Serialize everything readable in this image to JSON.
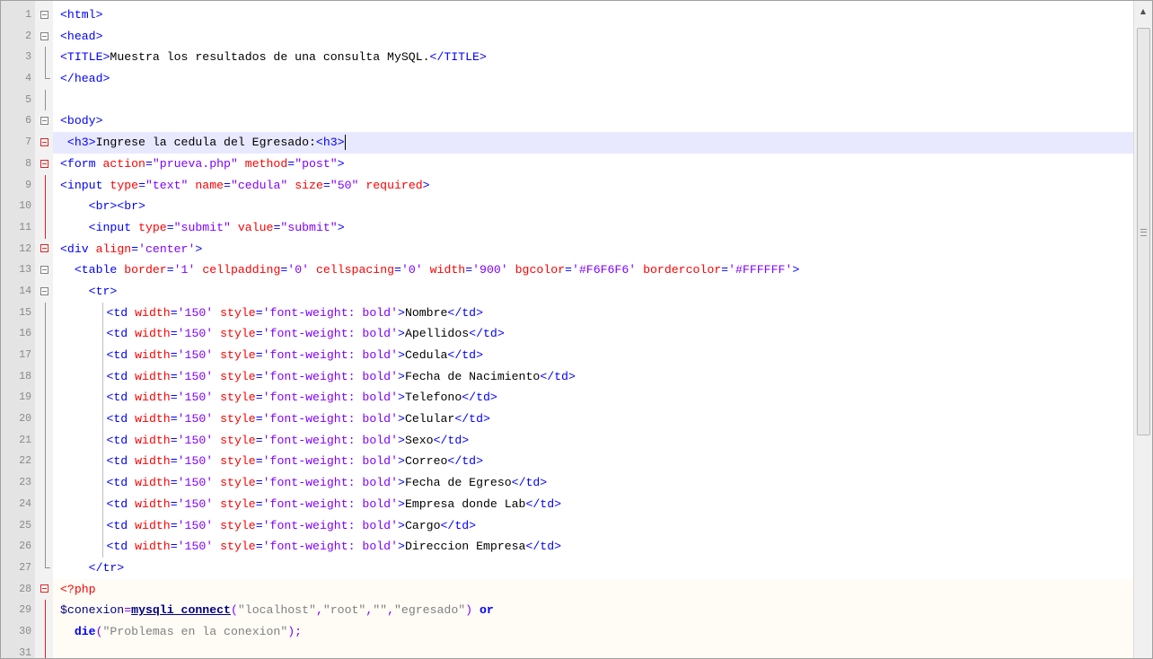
{
  "editor": {
    "scroll_up_glyph": "▲",
    "lines": [
      {
        "n": "1",
        "fold": "box",
        "tokens": [
          [
            "t-tag",
            "<html>"
          ]
        ]
      },
      {
        "n": "2",
        "fold": "box",
        "tokens": [
          [
            "t-tag",
            "<head>"
          ]
        ]
      },
      {
        "n": "3",
        "fold": "line-grey",
        "tokens": [
          [
            "t-tag",
            "<TITLE>"
          ],
          [
            "t-text",
            "Muestra los resultados de una consulta MySQL."
          ],
          [
            "t-tag",
            "</TITLE>"
          ]
        ]
      },
      {
        "n": "4",
        "fold": "end",
        "tokens": [
          [
            "t-tag",
            "</head>"
          ]
        ]
      },
      {
        "n": "5",
        "fold": "line-grey",
        "tokens": []
      },
      {
        "n": "6",
        "fold": "box",
        "tokens": [
          [
            "t-tag",
            "<body>"
          ]
        ]
      },
      {
        "n": "7",
        "fold": "box-red",
        "caret": true,
        "tokens": [
          [
            "t-text",
            " "
          ],
          [
            "t-tag",
            "<h3>"
          ],
          [
            "t-text",
            "Ingrese la cedula del Egresado:"
          ],
          [
            "t-tag",
            "<h3>"
          ]
        ]
      },
      {
        "n": "8",
        "fold": "box-red",
        "tokens": [
          [
            "t-tag",
            "<form "
          ],
          [
            "t-attr",
            "action"
          ],
          [
            "t-tag",
            "="
          ],
          [
            "t-val",
            "\"prueva.php\""
          ],
          [
            "t-tag",
            " "
          ],
          [
            "t-attr",
            "method"
          ],
          [
            "t-tag",
            "="
          ],
          [
            "t-val",
            "\"post\""
          ],
          [
            "t-tag",
            ">"
          ]
        ]
      },
      {
        "n": "9",
        "fold": "line-red",
        "tokens": [
          [
            "t-tag",
            "<input "
          ],
          [
            "t-attr",
            "type"
          ],
          [
            "t-tag",
            "="
          ],
          [
            "t-val",
            "\"text\""
          ],
          [
            "t-tag",
            " "
          ],
          [
            "t-attr",
            "name"
          ],
          [
            "t-tag",
            "="
          ],
          [
            "t-val",
            "\"cedula\""
          ],
          [
            "t-tag",
            " "
          ],
          [
            "t-attr",
            "size"
          ],
          [
            "t-tag",
            "="
          ],
          [
            "t-val",
            "\"50\""
          ],
          [
            "t-tag",
            " "
          ],
          [
            "t-attr",
            "required"
          ],
          [
            "t-tag",
            ">"
          ]
        ]
      },
      {
        "n": "10",
        "fold": "line-red",
        "indent": "    ",
        "tokens": [
          [
            "t-tag",
            "<br><br>"
          ]
        ]
      },
      {
        "n": "11",
        "fold": "line-red",
        "indent": "    ",
        "tokens": [
          [
            "t-tag",
            "<input "
          ],
          [
            "t-attr",
            "type"
          ],
          [
            "t-tag",
            "="
          ],
          [
            "t-val",
            "\"submit\""
          ],
          [
            "t-tag",
            " "
          ],
          [
            "t-attr",
            "value"
          ],
          [
            "t-tag",
            "="
          ],
          [
            "t-val",
            "\"submit\""
          ],
          [
            "t-tag",
            ">"
          ]
        ]
      },
      {
        "n": "12",
        "fold": "box-red",
        "tokens": [
          [
            "t-tag",
            "<div "
          ],
          [
            "t-attr",
            "align"
          ],
          [
            "t-tag",
            "="
          ],
          [
            "t-val",
            "'center'"
          ],
          [
            "t-tag",
            ">"
          ]
        ]
      },
      {
        "n": "13",
        "fold": "box",
        "indent": "  ",
        "tokens": [
          [
            "t-tag",
            "<table "
          ],
          [
            "t-attr",
            "border"
          ],
          [
            "t-tag",
            "="
          ],
          [
            "t-val",
            "'1'"
          ],
          [
            "t-tag",
            " "
          ],
          [
            "t-attr",
            "cellpadding"
          ],
          [
            "t-tag",
            "="
          ],
          [
            "t-val",
            "'0'"
          ],
          [
            "t-tag",
            " "
          ],
          [
            "t-attr",
            "cellspacing"
          ],
          [
            "t-tag",
            "="
          ],
          [
            "t-val",
            "'0'"
          ],
          [
            "t-tag",
            " "
          ],
          [
            "t-attr",
            "width"
          ],
          [
            "t-tag",
            "="
          ],
          [
            "t-val",
            "'900'"
          ],
          [
            "t-tag",
            " "
          ],
          [
            "t-attr",
            "bgcolor"
          ],
          [
            "t-tag",
            "="
          ],
          [
            "t-val",
            "'#F6F6F6'"
          ],
          [
            "t-tag",
            " "
          ],
          [
            "t-attr",
            "bordercolor"
          ],
          [
            "t-tag",
            "="
          ],
          [
            "t-val",
            "'#FFFFFF'"
          ],
          [
            "t-tag",
            ">"
          ]
        ]
      },
      {
        "n": "14",
        "fold": "box",
        "indent": "    ",
        "tokens": [
          [
            "t-tag",
            "<tr>"
          ]
        ]
      },
      {
        "n": "15",
        "fold": "line-grey",
        "guide": true,
        "tokens": [
          [
            "t-tag",
            "<td "
          ],
          [
            "t-attr",
            "width"
          ],
          [
            "t-tag",
            "="
          ],
          [
            "t-val",
            "'150'"
          ],
          [
            "t-tag",
            " "
          ],
          [
            "t-attr",
            "style"
          ],
          [
            "t-tag",
            "="
          ],
          [
            "t-val",
            "'font-weight: bold'"
          ],
          [
            "t-tag",
            ">"
          ],
          [
            "t-text",
            "Nombre"
          ],
          [
            "t-tag",
            "</td>"
          ]
        ]
      },
      {
        "n": "16",
        "fold": "line-grey",
        "guide": true,
        "tokens": [
          [
            "t-tag",
            "<td "
          ],
          [
            "t-attr",
            "width"
          ],
          [
            "t-tag",
            "="
          ],
          [
            "t-val",
            "'150'"
          ],
          [
            "t-tag",
            " "
          ],
          [
            "t-attr",
            "style"
          ],
          [
            "t-tag",
            "="
          ],
          [
            "t-val",
            "'font-weight: bold'"
          ],
          [
            "t-tag",
            ">"
          ],
          [
            "t-text",
            "Apellidos"
          ],
          [
            "t-tag",
            "</td>"
          ]
        ]
      },
      {
        "n": "17",
        "fold": "line-grey",
        "guide": true,
        "tokens": [
          [
            "t-tag",
            "<td "
          ],
          [
            "t-attr",
            "width"
          ],
          [
            "t-tag",
            "="
          ],
          [
            "t-val",
            "'150'"
          ],
          [
            "t-tag",
            " "
          ],
          [
            "t-attr",
            "style"
          ],
          [
            "t-tag",
            "="
          ],
          [
            "t-val",
            "'font-weight: bold'"
          ],
          [
            "t-tag",
            ">"
          ],
          [
            "t-text",
            "Cedula"
          ],
          [
            "t-tag",
            "</td>"
          ]
        ]
      },
      {
        "n": "18",
        "fold": "line-grey",
        "guide": true,
        "tokens": [
          [
            "t-tag",
            "<td "
          ],
          [
            "t-attr",
            "width"
          ],
          [
            "t-tag",
            "="
          ],
          [
            "t-val",
            "'150'"
          ],
          [
            "t-tag",
            " "
          ],
          [
            "t-attr",
            "style"
          ],
          [
            "t-tag",
            "="
          ],
          [
            "t-val",
            "'font-weight: bold'"
          ],
          [
            "t-tag",
            ">"
          ],
          [
            "t-text",
            "Fecha de Nacimiento"
          ],
          [
            "t-tag",
            "</td>"
          ]
        ]
      },
      {
        "n": "19",
        "fold": "line-grey",
        "guide": true,
        "tokens": [
          [
            "t-tag",
            "<td "
          ],
          [
            "t-attr",
            "width"
          ],
          [
            "t-tag",
            "="
          ],
          [
            "t-val",
            "'150'"
          ],
          [
            "t-tag",
            " "
          ],
          [
            "t-attr",
            "style"
          ],
          [
            "t-tag",
            "="
          ],
          [
            "t-val",
            "'font-weight: bold'"
          ],
          [
            "t-tag",
            ">"
          ],
          [
            "t-text",
            "Telefono"
          ],
          [
            "t-tag",
            "</td>"
          ]
        ]
      },
      {
        "n": "20",
        "fold": "line-grey",
        "guide": true,
        "tokens": [
          [
            "t-tag",
            "<td "
          ],
          [
            "t-attr",
            "width"
          ],
          [
            "t-tag",
            "="
          ],
          [
            "t-val",
            "'150'"
          ],
          [
            "t-tag",
            " "
          ],
          [
            "t-attr",
            "style"
          ],
          [
            "t-tag",
            "="
          ],
          [
            "t-val",
            "'font-weight: bold'"
          ],
          [
            "t-tag",
            ">"
          ],
          [
            "t-text",
            "Celular"
          ],
          [
            "t-tag",
            "</td>"
          ]
        ]
      },
      {
        "n": "21",
        "fold": "line-grey",
        "guide": true,
        "tokens": [
          [
            "t-tag",
            "<td "
          ],
          [
            "t-attr",
            "width"
          ],
          [
            "t-tag",
            "="
          ],
          [
            "t-val",
            "'150'"
          ],
          [
            "t-tag",
            " "
          ],
          [
            "t-attr",
            "style"
          ],
          [
            "t-tag",
            "="
          ],
          [
            "t-val",
            "'font-weight: bold'"
          ],
          [
            "t-tag",
            ">"
          ],
          [
            "t-text",
            "Sexo"
          ],
          [
            "t-tag",
            "</td>"
          ]
        ]
      },
      {
        "n": "22",
        "fold": "line-grey",
        "guide": true,
        "tokens": [
          [
            "t-tag",
            "<td "
          ],
          [
            "t-attr",
            "width"
          ],
          [
            "t-tag",
            "="
          ],
          [
            "t-val",
            "'150'"
          ],
          [
            "t-tag",
            " "
          ],
          [
            "t-attr",
            "style"
          ],
          [
            "t-tag",
            "="
          ],
          [
            "t-val",
            "'font-weight: bold'"
          ],
          [
            "t-tag",
            ">"
          ],
          [
            "t-text",
            "Correo"
          ],
          [
            "t-tag",
            "</td>"
          ]
        ]
      },
      {
        "n": "23",
        "fold": "line-grey",
        "guide": true,
        "tokens": [
          [
            "t-tag",
            "<td "
          ],
          [
            "t-attr",
            "width"
          ],
          [
            "t-tag",
            "="
          ],
          [
            "t-val",
            "'150'"
          ],
          [
            "t-tag",
            " "
          ],
          [
            "t-attr",
            "style"
          ],
          [
            "t-tag",
            "="
          ],
          [
            "t-val",
            "'font-weight: bold'"
          ],
          [
            "t-tag",
            ">"
          ],
          [
            "t-text",
            "Fecha de Egreso"
          ],
          [
            "t-tag",
            "</td>"
          ]
        ]
      },
      {
        "n": "24",
        "fold": "line-grey",
        "guide": true,
        "tokens": [
          [
            "t-tag",
            "<td "
          ],
          [
            "t-attr",
            "width"
          ],
          [
            "t-tag",
            "="
          ],
          [
            "t-val",
            "'150'"
          ],
          [
            "t-tag",
            " "
          ],
          [
            "t-attr",
            "style"
          ],
          [
            "t-tag",
            "="
          ],
          [
            "t-val",
            "'font-weight: bold'"
          ],
          [
            "t-tag",
            ">"
          ],
          [
            "t-text",
            "Empresa donde Lab"
          ],
          [
            "t-tag",
            "</td>"
          ]
        ]
      },
      {
        "n": "25",
        "fold": "line-grey",
        "guide": true,
        "tokens": [
          [
            "t-tag",
            "<td "
          ],
          [
            "t-attr",
            "width"
          ],
          [
            "t-tag",
            "="
          ],
          [
            "t-val",
            "'150'"
          ],
          [
            "t-tag",
            " "
          ],
          [
            "t-attr",
            "style"
          ],
          [
            "t-tag",
            "="
          ],
          [
            "t-val",
            "'font-weight: bold'"
          ],
          [
            "t-tag",
            ">"
          ],
          [
            "t-text",
            "Cargo"
          ],
          [
            "t-tag",
            "</td>"
          ]
        ]
      },
      {
        "n": "26",
        "fold": "line-grey",
        "guide": true,
        "tokens": [
          [
            "t-tag",
            "<td "
          ],
          [
            "t-attr",
            "width"
          ],
          [
            "t-tag",
            "="
          ],
          [
            "t-val",
            "'150'"
          ],
          [
            "t-tag",
            " "
          ],
          [
            "t-attr",
            "style"
          ],
          [
            "t-tag",
            "="
          ],
          [
            "t-val",
            "'font-weight: bold'"
          ],
          [
            "t-tag",
            ">"
          ],
          [
            "t-text",
            "Direccion Empresa"
          ],
          [
            "t-tag",
            "</td>"
          ]
        ]
      },
      {
        "n": "27",
        "fold": "end",
        "indent": "    ",
        "tokens": [
          [
            "t-tag",
            "</tr>"
          ]
        ]
      },
      {
        "n": "28",
        "fold": "box-red",
        "php": true,
        "tokens": [
          [
            "t-php",
            "<?php"
          ]
        ]
      },
      {
        "n": "29",
        "fold": "line-red",
        "php": true,
        "tokens": [
          [
            "t-var",
            "$conexion"
          ],
          [
            "t-op",
            "="
          ],
          [
            "t-fn",
            "mysqli_connect"
          ],
          [
            "t-op",
            "("
          ],
          [
            "t-str",
            "\"localhost\""
          ],
          [
            "t-op",
            ","
          ],
          [
            "t-str",
            "\"root\""
          ],
          [
            "t-op",
            ","
          ],
          [
            "t-str",
            "\"\""
          ],
          [
            "t-op",
            ","
          ],
          [
            "t-str",
            "\"egresado\""
          ],
          [
            "t-op",
            ")"
          ],
          [
            "t-text",
            " "
          ],
          [
            "t-kw",
            "or"
          ]
        ]
      },
      {
        "n": "30",
        "fold": "line-red",
        "php": true,
        "indent": "  ",
        "tokens": [
          [
            "t-kw",
            "die"
          ],
          [
            "t-op",
            "("
          ],
          [
            "t-str",
            "\"Problemas en la conexion\""
          ],
          [
            "t-op",
            ");"
          ]
        ]
      },
      {
        "n": "31",
        "fold": "line-red",
        "php": true,
        "tokens": []
      }
    ]
  }
}
